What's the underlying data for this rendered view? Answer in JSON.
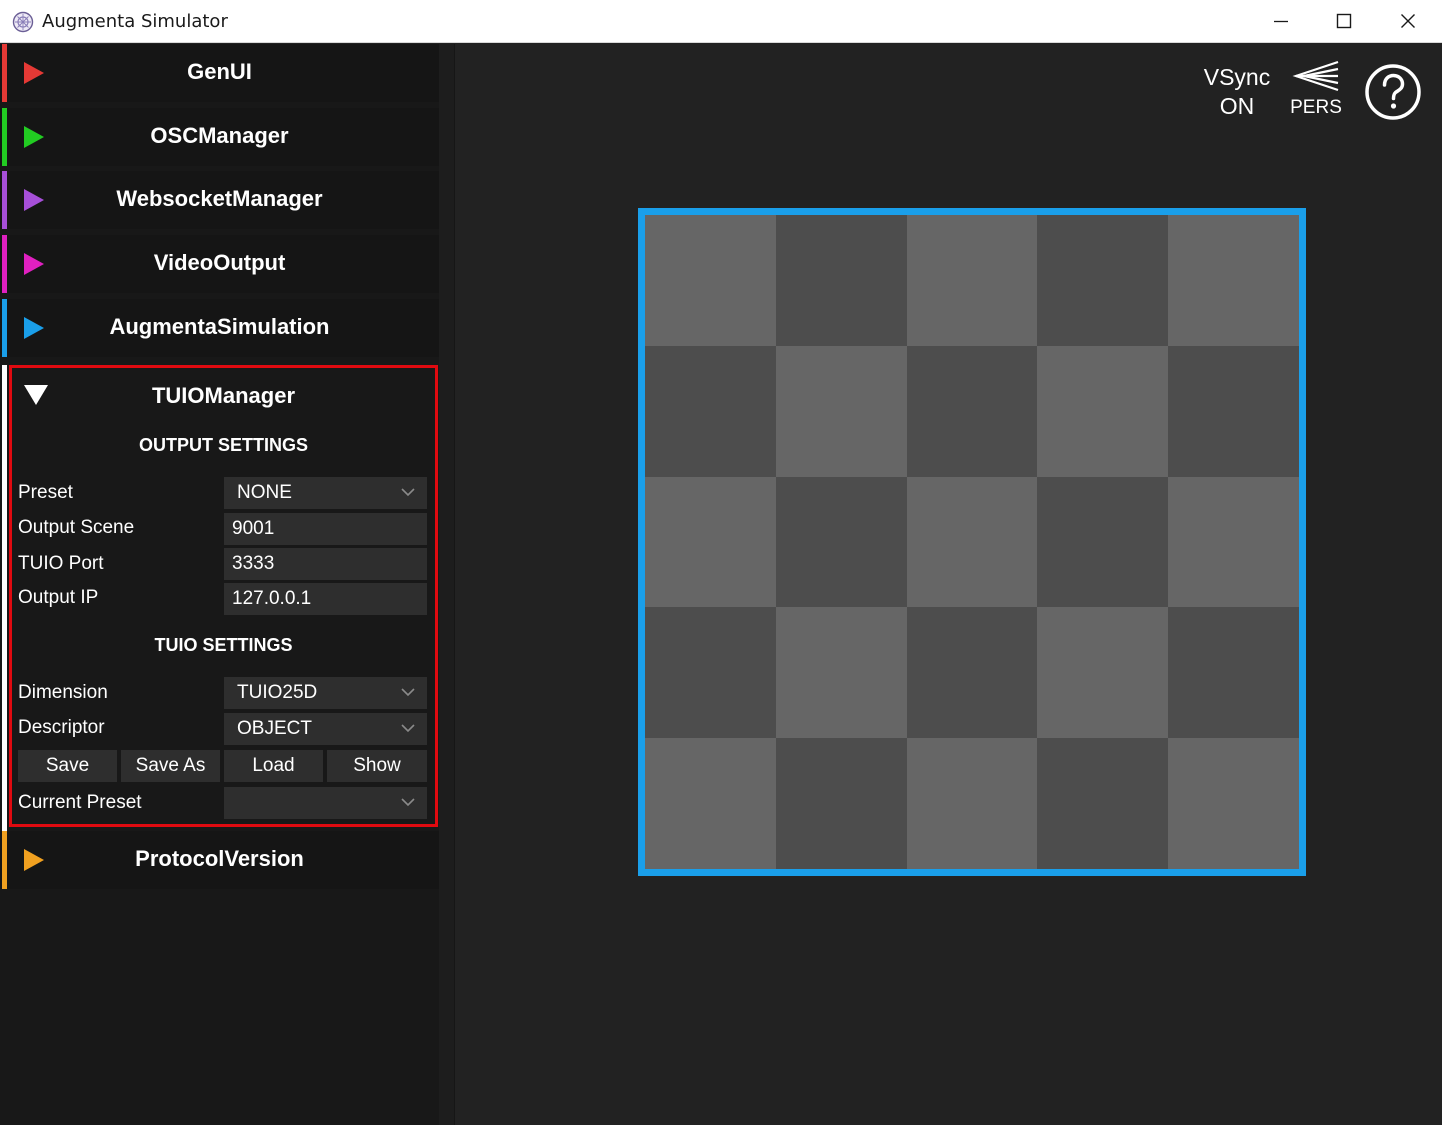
{
  "window": {
    "title": "Augmenta Simulator",
    "icon": "app-logo-icon",
    "controls": [
      "minimize-icon",
      "maximize-icon",
      "close-icon"
    ]
  },
  "sections": [
    {
      "label": "GenUI",
      "color": "#e53935",
      "expanded": false
    },
    {
      "label": "OSCManager",
      "color": "#22cc22",
      "expanded": false
    },
    {
      "label": "WebsocketManager",
      "color": "#a64fd8",
      "expanded": false
    },
    {
      "label": "VideoOutput",
      "color": "#e020c0",
      "expanded": false
    },
    {
      "label": "AugmentaSimulation",
      "color": "#1a9fea",
      "expanded": false
    }
  ],
  "tuio": {
    "label": "TUIOManager",
    "output_heading": "OUTPUT SETTINGS",
    "preset_label": "Preset",
    "preset_value": "NONE",
    "scene_label": "Output Scene",
    "scene_value": "9001",
    "port_label": "TUIO Port",
    "port_value": "3333",
    "ip_label": "Output IP",
    "ip_value": "127.0.0.1",
    "tuio_heading": "TUIO SETTINGS",
    "dimension_label": "Dimension",
    "dimension_value": "TUIO25D",
    "descriptor_label": "Descriptor",
    "descriptor_value": "OBJECT",
    "buttons": {
      "save": "Save",
      "save_as": "Save As",
      "load": "Load",
      "show": "Show"
    },
    "current_preset_label": "Current Preset",
    "current_preset_value": ""
  },
  "protocol": {
    "label": "ProtocolVersion",
    "color": "#f0a020",
    "expanded": false
  },
  "toolbar": {
    "vsync_label": "VSync",
    "vsync_state": "ON",
    "pers_label": "PERS",
    "help_icon": "help-icon"
  },
  "scene": {
    "border_color": "#1a9fea",
    "grid": {
      "rows": 5,
      "cols": 5
    },
    "light_color": "#666666",
    "dark_color": "#4d4d4d"
  }
}
